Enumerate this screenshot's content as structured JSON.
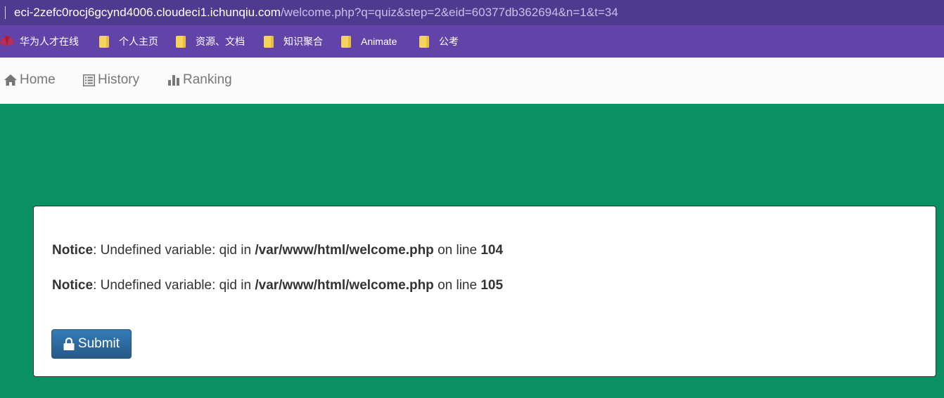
{
  "browser": {
    "url_host": "eci-2zefc0rocj6gcynd4006.cloudeci1.ichunqiu.com",
    "url_path": "/welcome.php?q=quiz&step=2&eid=60377db362694&n=1&t=34"
  },
  "bookmarks": [
    {
      "label": "华为人才在线",
      "icon": "huawei-logo-icon"
    },
    {
      "label": "个人主页",
      "icon": "folder-icon"
    },
    {
      "label": "资源、文档",
      "icon": "folder-icon"
    },
    {
      "label": "知识聚合",
      "icon": "folder-icon"
    },
    {
      "label": "Animate",
      "icon": "folder-icon"
    },
    {
      "label": "公考",
      "icon": "folder-icon"
    }
  ],
  "nav": {
    "home": "Home",
    "history": "History",
    "ranking": "Ranking"
  },
  "notices": [
    {
      "label": "Notice",
      "message": ": Undefined variable: qid in ",
      "file": "/var/www/html/welcome.php",
      "on_line": " on line ",
      "line": "104"
    },
    {
      "label": "Notice",
      "message": ": Undefined variable: qid in ",
      "file": "/var/www/html/welcome.php",
      "on_line": " on line ",
      "line": "105"
    }
  ],
  "submit_label": "Submit",
  "colors": {
    "page_background": "#0a9163",
    "address_bar": "#4f3a8f",
    "bookmarks_bar": "#6244a8",
    "button": "#337ab7"
  }
}
